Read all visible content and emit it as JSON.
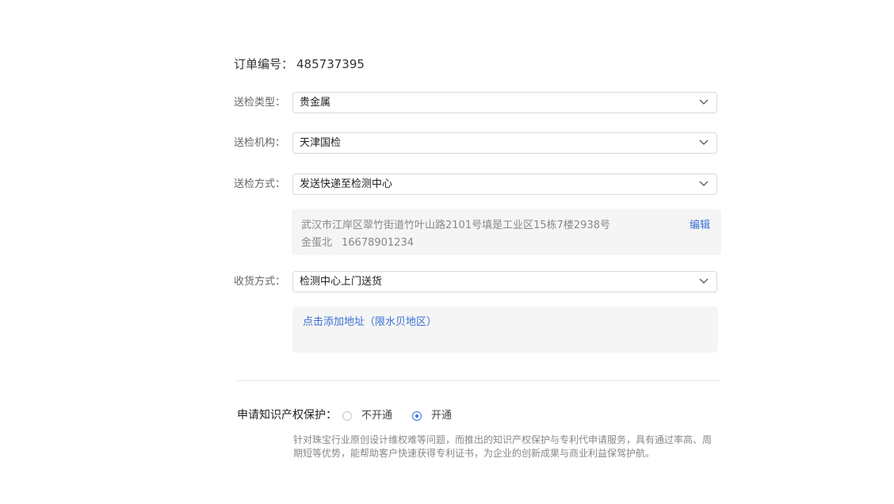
{
  "order": {
    "label": "订单编号：",
    "value": "485737395"
  },
  "fields": {
    "inspection_type": {
      "label": "送检类型：",
      "value": "贵金属"
    },
    "inspection_agency": {
      "label": "送检机构：",
      "value": "天津国检"
    },
    "inspection_method": {
      "label": "送检方式：",
      "value": "发送快递至检测中心"
    },
    "receipt_method": {
      "label": "收货方式：",
      "value": "检测中心上门送货"
    }
  },
  "address": {
    "line": "武汉市江岸区翠竹街道竹叶山路2101号填是工业区15栋7楼2938号",
    "name": "金蛋北",
    "phone": "16678901234",
    "edit_label": "编辑"
  },
  "add_address": {
    "label": "点击添加地址（限水贝地区）"
  },
  "ip_protection": {
    "label": "申请知识产权保护：",
    "options": [
      {
        "label": "不开通",
        "selected": false
      },
      {
        "label": "开通",
        "selected": true
      }
    ],
    "description": "针对珠宝行业原创设计维权难等问题，而推出的知识产权保护与专利代申请服务，具有通过率高、周期短等优势，能帮助客户快速获得专利证书，为企业的创新成果与商业利益保驾护航。"
  },
  "icons": {
    "dropdown": "chevron-down-icon",
    "radio_off": "radio-unchecked-icon",
    "radio_on": "radio-checked-icon"
  },
  "colors": {
    "accent": "#3a6fd8",
    "panel_bg": "#f5f5f5",
    "border": "#d9d9d9"
  }
}
